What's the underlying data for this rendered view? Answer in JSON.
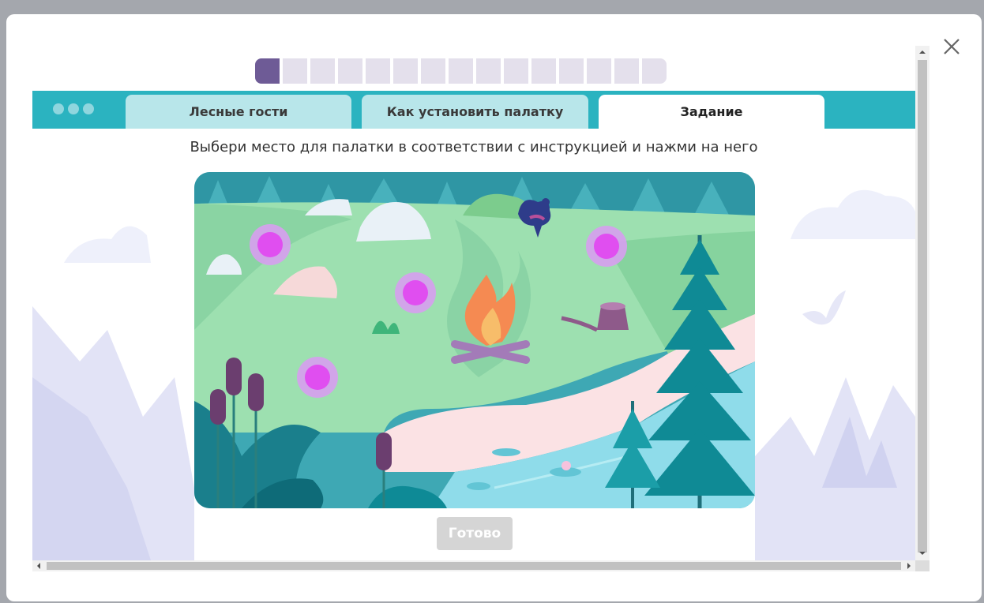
{
  "close_icon": "close-icon",
  "progress": {
    "total": 16,
    "current": 1
  },
  "tabs": [
    {
      "label": "Лесные гости",
      "active": false
    },
    {
      "label": "Как установить палатку",
      "active": false
    },
    {
      "label": "Задание",
      "active": true
    }
  ],
  "instruction": "Выбери место для палатки в соответствии с инструкцией и нажми на него",
  "scene": {
    "hotspots": 4,
    "hotspot_color": "#e04ef0",
    "elements": [
      "campfire-icon",
      "capercaillie-icon",
      "spruce-tree-icon",
      "cattail-icon",
      "stump-icon",
      "anthill-icon",
      "river",
      "rocks"
    ]
  },
  "ready_button": {
    "label": "Готово",
    "disabled": true
  },
  "colors": {
    "tab_bar": "#2bb3c0",
    "progress_active": "#6e5b96",
    "progress_inactive": "#e4e0ec"
  }
}
